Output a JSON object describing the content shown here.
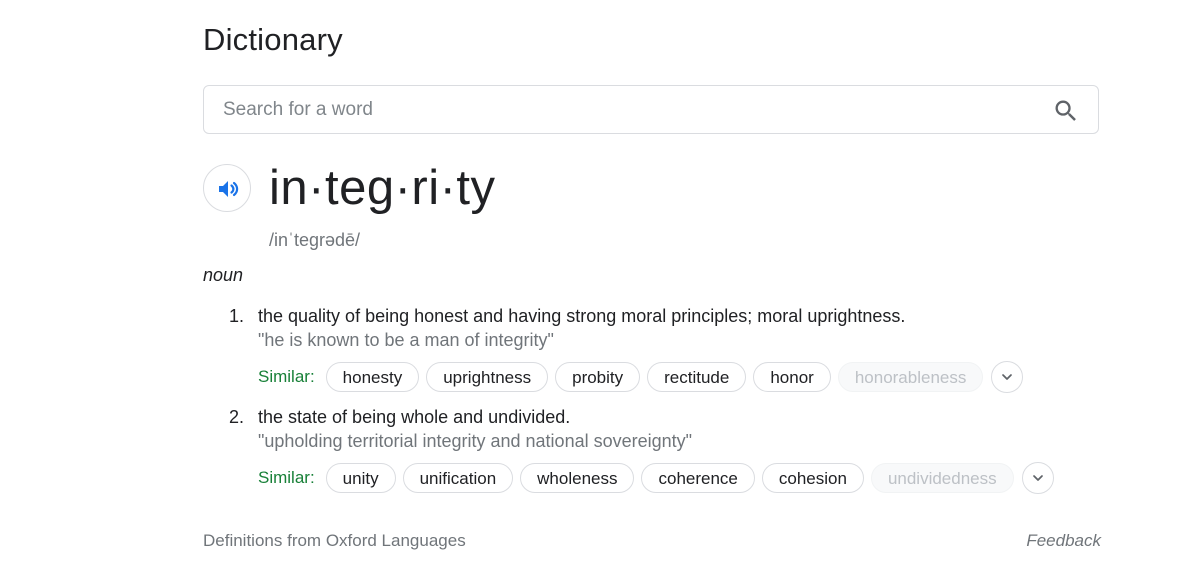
{
  "title": "Dictionary",
  "search": {
    "placeholder": "Search for a word",
    "value": "",
    "icon": "search-icon"
  },
  "entry": {
    "headword": "in·teg·ri·ty",
    "phonetic": "/inˈteɡrədē/",
    "speaker_icon": "speaker-icon",
    "part_of_speech": "noun",
    "senses": [
      {
        "number": "1.",
        "definition": "the quality of being honest and having strong moral principles; moral uprightness.",
        "example": "\"he is known to be a man of integrity\"",
        "similar_label": "Similar:",
        "similar": [
          "honesty",
          "uprightness",
          "probity",
          "rectitude",
          "honor",
          "honorableness"
        ],
        "expand_icon": "chevron-down-icon"
      },
      {
        "number": "2.",
        "definition": "the state of being whole and undivided.",
        "example": "\"upholding territorial integrity and national sovereignty\"",
        "similar_label": "Similar:",
        "similar": [
          "unity",
          "unification",
          "wholeness",
          "coherence",
          "cohesion",
          "undividedness"
        ],
        "expand_icon": "chevron-down-icon"
      }
    ]
  },
  "footer": {
    "source": "Definitions from Oxford Languages",
    "feedback": "Feedback"
  },
  "colors": {
    "text": "#202124",
    "secondary_text": "#70757a",
    "similar_green": "#188038",
    "speaker_blue": "#1a73e8",
    "border": "#dadce0"
  }
}
